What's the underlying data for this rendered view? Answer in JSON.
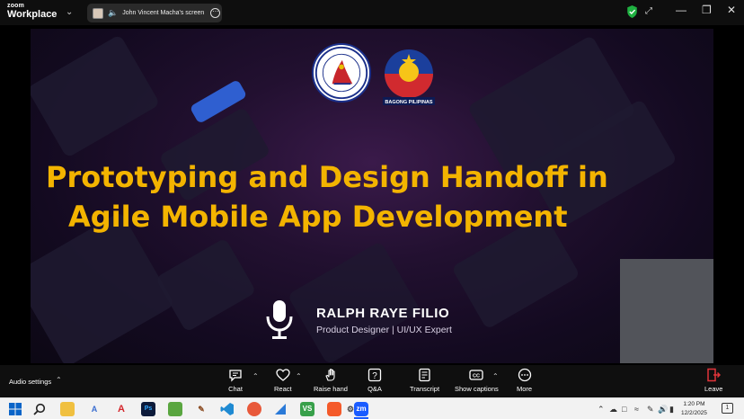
{
  "window": {
    "app_name_small": "zoom",
    "app_name": "Workplace",
    "share_tab_label": "John Vincent Macha's screen"
  },
  "slide": {
    "bagong_text": "BAGONG PILIPINAS",
    "title_line1": "Prototyping and Design Handoff in",
    "title_line2": "Agile Mobile App Development",
    "presenter_name": "RALPH RAYE FILIO",
    "presenter_role": "Product Designer | UI/UX Expert",
    "title_color": "#f3b400"
  },
  "toolbar": {
    "audio_settings": "Audio settings",
    "buttons": [
      {
        "label": "Chat",
        "icon": "chat-icon"
      },
      {
        "label": "React",
        "icon": "heart-icon"
      },
      {
        "label": "Raise hand",
        "icon": "hand-icon"
      },
      {
        "label": "Q&A",
        "icon": "qa-icon"
      },
      {
        "label": "Transcript",
        "icon": "transcript-icon"
      },
      {
        "label": "Show captions",
        "icon": "cc-icon"
      },
      {
        "label": "More",
        "icon": "more-icon"
      }
    ],
    "leave_label": "Leave",
    "leave_color": "#e0343a"
  },
  "taskbar": {
    "time": "1:20 PM",
    "date": "12/2/2025",
    "apps": [
      "windows-icon",
      "search-icon",
      "file-explorer-icon",
      "app-a-icon",
      "acrobat-icon",
      "photoshop-icon",
      "brush-icon",
      "app-icon",
      "vscode-icon",
      "arrow-app-icon",
      "sail-icon",
      "vs-icon",
      "brave-icon",
      "settings-icon",
      "zoom-icon"
    ]
  }
}
